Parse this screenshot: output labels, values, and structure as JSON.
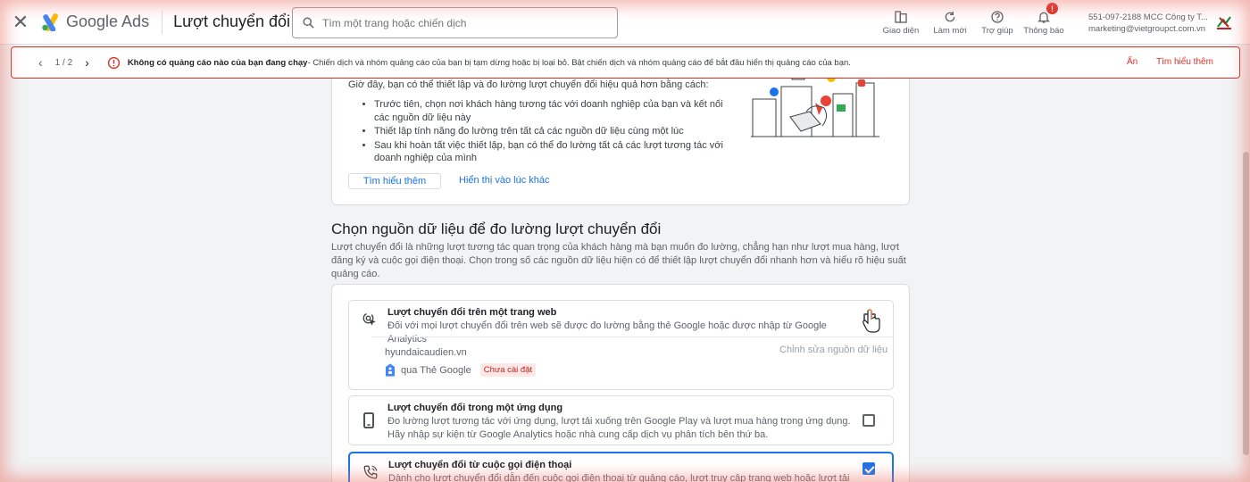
{
  "header": {
    "app_name": "Google Ads",
    "page_title": "Lượt chuyển đổi",
    "search_placeholder": "Tìm một trang hoặc chiến dịch",
    "actions": [
      {
        "label": "Giao diện",
        "icon": "appearance-icon"
      },
      {
        "label": "Làm mới",
        "icon": "refresh-icon"
      },
      {
        "label": "Trợ giúp",
        "icon": "help-icon"
      },
      {
        "label": "Thông báo",
        "icon": "bell-icon",
        "badge": "!"
      }
    ],
    "account": {
      "line1": "551-097-2188 MCC Công ty T...",
      "line2": "marketing@vietgroupct.com.vn"
    }
  },
  "alert": {
    "pager": "1 / 2",
    "title": "Không có quảng cáo nào của bạn đang chạy",
    "message": " - Chiến dịch và nhóm quảng cáo của bạn bị tạm dừng hoặc bị loại bỏ. Bật chiến dịch và nhóm quảng cáo để bắt đầu hiển thị quảng cáo của bạn.",
    "hide_label": "Ẩn",
    "learn_more_label": "Tìm hiểu thêm"
  },
  "intro": {
    "lead": "Giờ đây, bạn có thể thiết lập và đo lường lượt chuyển đổi hiệu quả hơn bằng cách:",
    "bullets": [
      "Trước tiên, chọn nơi khách hàng tương tác với doanh nghiệp của bạn và kết nối các nguồn dữ liệu này",
      "Thiết lập tính năng đo lường trên tất cả các nguồn dữ liệu cùng một lúc",
      "Sau khi hoàn tất việc thiết lập, bạn có thể đo lường tất cả các lượt tương tác với doanh nghiệp của mình"
    ],
    "learn_more_label": "Tìm hiểu thêm",
    "later_label": "Hiển thị vào lúc khác"
  },
  "section": {
    "title": "Chọn nguồn dữ liệu để đo lường lượt chuyển đổi",
    "description": "Lượt chuyển đổi là những lượt tương tác quan trọng của khách hàng mà bạn muốn đo lường, chẳng hạn như lượt mua hàng, lượt đăng ký và cuộc gọi điện thoại. Chọn trong số các nguồn dữ liệu hiện có để thiết lập lượt chuyển đổi nhanh hơn và hiểu rõ hiệu suất quảng cáo."
  },
  "options": [
    {
      "title": "Lượt chuyển đổi trên một trang web",
      "description": "Đối với mọi lượt chuyển đổi trên web sẽ được đo lường bằng thẻ Google hoặc được nhập từ Google Analytics",
      "checked": false,
      "domain": "hyundaicaudien.vn",
      "edit_label": "Chỉnh sửa nguồn dữ liệu",
      "via_label": "qua Thẻ Google",
      "status_badge": "Chưa cài đặt"
    },
    {
      "title": "Lượt chuyển đổi trong một ứng dụng",
      "description": "Đo lường lượt tương tác với ứng dụng, lượt tải xuống trên Google Play và lượt mua hàng trong ứng dụng. Hãy nhập sự kiện từ Google Analytics hoặc nhà cung cấp dịch vụ phân tích bên thứ ba.",
      "checked": false
    },
    {
      "title": "Lượt chuyển đổi từ cuộc gọi điện thoại",
      "description": "Dành cho lượt chuyển đổi dẫn đến cuộc gọi điện thoại từ quảng cáo, lượt truy cập trang web hoặc lượt tải lên",
      "checked": true
    }
  ],
  "colors": {
    "accent": "#1a73e8",
    "error": "#d93025",
    "badge_bg": "#fce8e6"
  }
}
